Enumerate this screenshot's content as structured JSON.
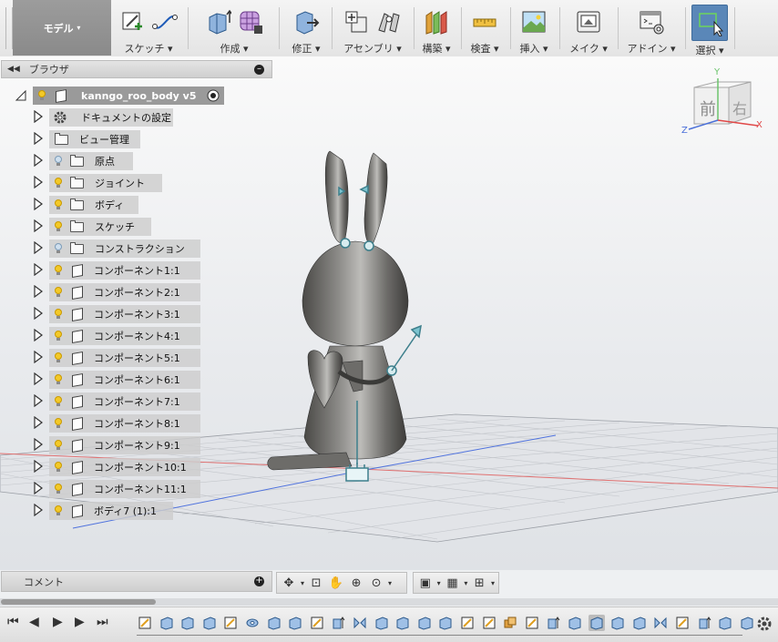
{
  "toolbar": {
    "workspace": "モデル",
    "groups": [
      {
        "label": "スケッチ"
      },
      {
        "label": "作成"
      },
      {
        "label": "修正"
      },
      {
        "label": "アセンブリ"
      },
      {
        "label": "構築"
      },
      {
        "label": "検査"
      },
      {
        "label": "挿入"
      },
      {
        "label": "メイク"
      },
      {
        "label": "アドイン"
      },
      {
        "label": "選択"
      }
    ]
  },
  "browser": {
    "title": "ブラウザ",
    "root": "kanngo_roo_body v5",
    "items": [
      {
        "label": "ドキュメントの設定",
        "icon": "gear-icon"
      },
      {
        "label": "ビュー管理",
        "icon": "folder-icon"
      },
      {
        "label": "原点",
        "icon": "folder-icon",
        "bulb": "off"
      },
      {
        "label": "ジョイント",
        "icon": "folder-icon",
        "bulb": "on"
      },
      {
        "label": "ボディ",
        "icon": "folder-icon",
        "bulb": "on"
      },
      {
        "label": "スケッチ",
        "icon": "folder-icon",
        "bulb": "on"
      },
      {
        "label": "コンストラクション",
        "icon": "folder-icon",
        "bulb": "off"
      },
      {
        "label": "コンポーネント1:1",
        "icon": "component-icon",
        "bulb": "on"
      },
      {
        "label": "コンポーネント2:1",
        "icon": "component-icon",
        "bulb": "on"
      },
      {
        "label": "コンポーネント3:1",
        "icon": "component-icon",
        "bulb": "on"
      },
      {
        "label": "コンポーネント4:1",
        "icon": "component-icon",
        "bulb": "on"
      },
      {
        "label": "コンポーネント5:1",
        "icon": "component-icon",
        "bulb": "on"
      },
      {
        "label": "コンポーネント6:1",
        "icon": "component-icon",
        "bulb": "on"
      },
      {
        "label": "コンポーネント7:1",
        "icon": "component-icon",
        "bulb": "on"
      },
      {
        "label": "コンポーネント8:1",
        "icon": "component-icon",
        "bulb": "on"
      },
      {
        "label": "コンポーネント9:1",
        "icon": "component-icon",
        "bulb": "on"
      },
      {
        "label": "コンポーネント10:1",
        "icon": "component-icon",
        "bulb": "on"
      },
      {
        "label": "コンポーネント11:1",
        "icon": "component-icon",
        "bulb": "on"
      },
      {
        "label": "ボディ7 (1):1",
        "icon": "component-icon",
        "bulb": "on"
      }
    ]
  },
  "viewcube": {
    "front": "前",
    "right": "右",
    "axis_y": "Y",
    "axis_x": "X",
    "axis_z": "Z"
  },
  "comments": {
    "title": "コメント"
  },
  "colors": {
    "accent": "#5a87b8",
    "axis_x": "#e04848",
    "axis_y": "#6cc46c",
    "axis_z": "#4a6fd8",
    "model": "#6b6a67"
  }
}
